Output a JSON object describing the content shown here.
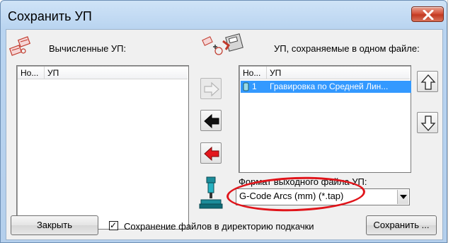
{
  "window": {
    "title": "Сохранить УП",
    "close_label": "✕"
  },
  "left_panel": {
    "label": "Вычисленные УП:",
    "icon": "toolpath-list-icon",
    "columns": [
      "Но...",
      "УП"
    ],
    "rows": []
  },
  "right_panel": {
    "label": "УП, сохраняемые в одном файле:",
    "icon": "save-toolpath-to-file-icon",
    "columns": [
      "Но...",
      "УП"
    ],
    "rows": [
      {
        "number": "1",
        "name": "Гравировка по Средней Лин...",
        "selected": true
      }
    ]
  },
  "transfer_buttons": {
    "add_icon": "arrow-right-icon",
    "remove_icon": "arrow-left-icon",
    "remove_all_icon": "arrow-left-red-icon"
  },
  "order_buttons": {
    "up_icon": "arrow-up-icon",
    "down_icon": "arrow-down-icon"
  },
  "format": {
    "label": "Формат выходного файла УП:",
    "selected": "G-Code Arcs (mm) (*.tap)",
    "icon": "machine-post-icon"
  },
  "footer": {
    "close_label": "Закрыть",
    "checkbox_label": "Сохранение файлов в директорию подкачки",
    "checkbox_checked": true,
    "checkbox_mark": "✓",
    "save_label": "Сохранить ..."
  },
  "colors": {
    "selection": "#3399ff",
    "highlight_ring": "#e0141a",
    "close_button": "#c23a22"
  }
}
